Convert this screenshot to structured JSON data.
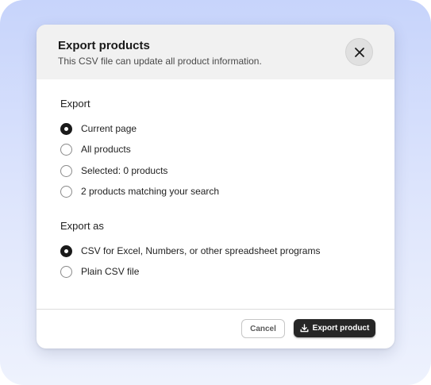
{
  "modal": {
    "title": "Export products",
    "subtitle": "This CSV file can update all product information.",
    "close_icon": "close-icon"
  },
  "export": {
    "label": "Export",
    "options": [
      {
        "label": "Current page",
        "checked": true
      },
      {
        "label": "All products",
        "checked": false
      },
      {
        "label": "Selected: 0 products",
        "checked": false
      },
      {
        "label": "2 products matching your search",
        "checked": false
      }
    ]
  },
  "export_as": {
    "label": "Export as",
    "options": [
      {
        "label": "CSV for Excel, Numbers, or other spreadsheet programs",
        "checked": true
      },
      {
        "label": "Plain CSV file",
        "checked": false
      }
    ]
  },
  "footer": {
    "cancel_label": "Cancel",
    "export_label": "Export product",
    "export_icon": "download-icon"
  },
  "colors": {
    "primary_button": "#262626",
    "header_bg": "#f1f1f1",
    "backdrop": "#c7d4fb"
  }
}
